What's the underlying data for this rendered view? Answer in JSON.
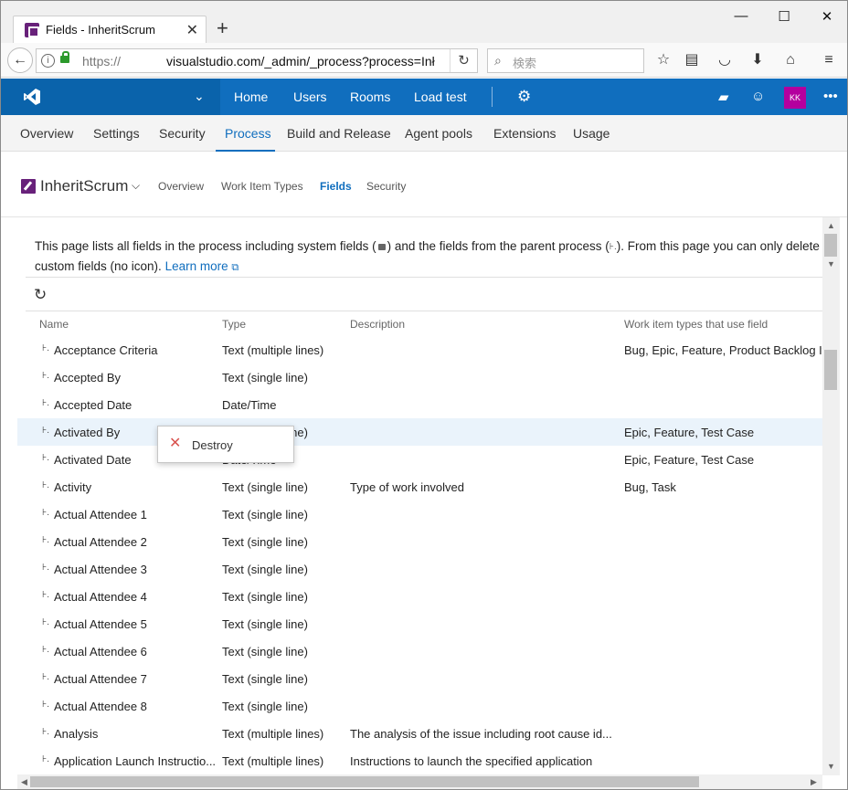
{
  "browser": {
    "tab_title": "Fields - InheritScrum",
    "tab_close": "✕",
    "new_tab": "+",
    "window_minimize": "—",
    "window_maximize": "☐",
    "window_close": "✕",
    "url_protocol": "https://",
    "url_host": "visualstudio.com/_admin/_process?process=Inł",
    "search_placeholder": "検索"
  },
  "header": {
    "nav": [
      "Home",
      "Users",
      "Rooms",
      "Load test"
    ],
    "avatar_initials": "KK"
  },
  "hubs": [
    "Overview",
    "Settings",
    "Security",
    "Process",
    "Build and Release",
    "Agent pools",
    "Extensions",
    "Usage"
  ],
  "process": {
    "name": "InheritScrum",
    "tabs": [
      "Overview",
      "Work Item Types",
      "Fields",
      "Security"
    ]
  },
  "info": {
    "text_1": "This page lists all fields in the process including system fields (",
    "text_2": ") and the fields from the parent process (",
    "text_3": "). From this page you can only delete custom fields (no icon).",
    "learn_more": "Learn more"
  },
  "table": {
    "columns": [
      "Name",
      "Type",
      "Description",
      "Work item types that use field"
    ],
    "rows": [
      {
        "name": "Acceptance Criteria",
        "type": "Text (multiple lines)",
        "desc": "",
        "wit": "Bug, Epic, Feature, Product Backlog Ite"
      },
      {
        "name": "Accepted By",
        "type": "Text (single line)",
        "desc": "",
        "wit": ""
      },
      {
        "name": "Accepted Date",
        "type": "Date/Time",
        "desc": "",
        "wit": ""
      },
      {
        "name": "Activated By",
        "type": "Text (single line)",
        "desc": "",
        "wit": "Epic, Feature, Test Case"
      },
      {
        "name": "Activated Date",
        "type": "Date/Time",
        "desc": "",
        "wit": "Epic, Feature, Test Case"
      },
      {
        "name": "Activity",
        "type": "Text (single line)",
        "desc": "Type of work involved",
        "wit": "Bug, Task"
      },
      {
        "name": "Actual Attendee 1",
        "type": "Text (single line)",
        "desc": "",
        "wit": ""
      },
      {
        "name": "Actual Attendee 2",
        "type": "Text (single line)",
        "desc": "",
        "wit": ""
      },
      {
        "name": "Actual Attendee 3",
        "type": "Text (single line)",
        "desc": "",
        "wit": ""
      },
      {
        "name": "Actual Attendee 4",
        "type": "Text (single line)",
        "desc": "",
        "wit": ""
      },
      {
        "name": "Actual Attendee 5",
        "type": "Text (single line)",
        "desc": "",
        "wit": ""
      },
      {
        "name": "Actual Attendee 6",
        "type": "Text (single line)",
        "desc": "",
        "wit": ""
      },
      {
        "name": "Actual Attendee 7",
        "type": "Text (single line)",
        "desc": "",
        "wit": ""
      },
      {
        "name": "Actual Attendee 8",
        "type": "Text (single line)",
        "desc": "",
        "wit": ""
      },
      {
        "name": "Analysis",
        "type": "Text (multiple lines)",
        "desc": "The analysis of the issue including root cause id...",
        "wit": ""
      },
      {
        "name": "Application Launch Instructio...",
        "type": "Text (multiple lines)",
        "desc": "Instructions to launch the specified application",
        "wit": ""
      }
    ]
  },
  "context_menu": {
    "destroy_label": "Destroy"
  }
}
